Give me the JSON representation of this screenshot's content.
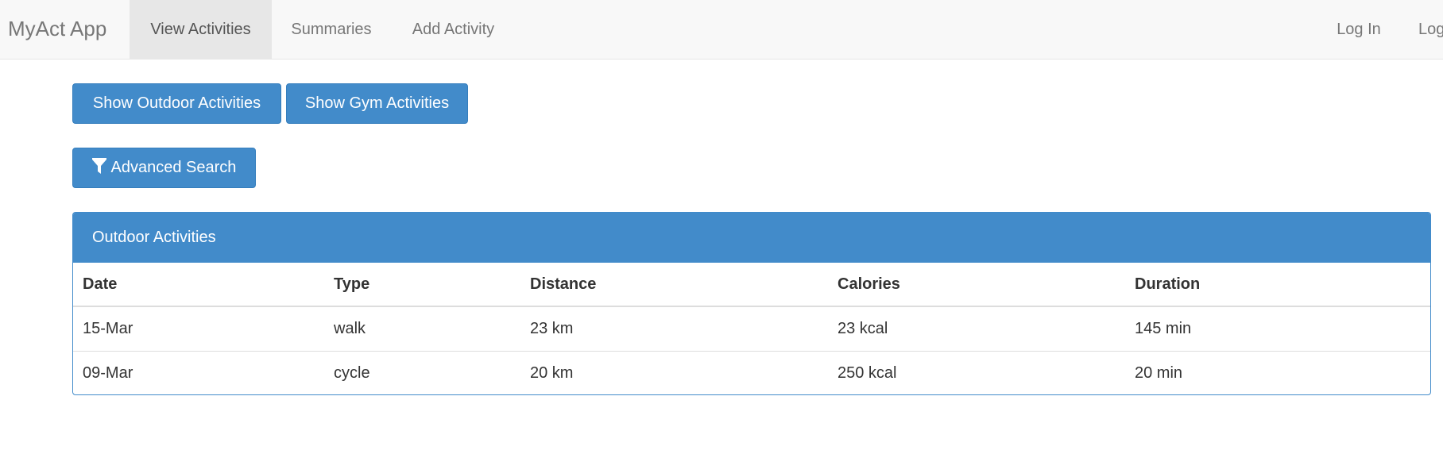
{
  "navbar": {
    "brand": "MyAct App",
    "items": [
      {
        "label": "View Activities",
        "active": true
      },
      {
        "label": "Summaries",
        "active": false
      },
      {
        "label": "Add Activity",
        "active": false
      }
    ],
    "right_items": [
      {
        "label": "Log In"
      },
      {
        "label": "Log"
      }
    ]
  },
  "buttons": {
    "outdoor_label": "Show Outdoor Activities",
    "gym_label": "Show Gym Activities",
    "search_label": "Advanced Search",
    "search_icon": "filter-icon"
  },
  "panel": {
    "title": "Outdoor Activities",
    "headers": [
      "Date",
      "Type",
      "Distance",
      "Calories",
      "Duration"
    ],
    "rows": [
      [
        "15-Mar",
        "walk",
        "23 km",
        "23 kcal",
        "145 min"
      ],
      [
        "09-Mar",
        "cycle",
        "20 km",
        "250 kcal",
        "20 min"
      ]
    ]
  },
  "colors": {
    "primary": "#428bca",
    "navbar_bg": "#f8f8f8",
    "nav_active_bg": "#e7e7e7"
  }
}
